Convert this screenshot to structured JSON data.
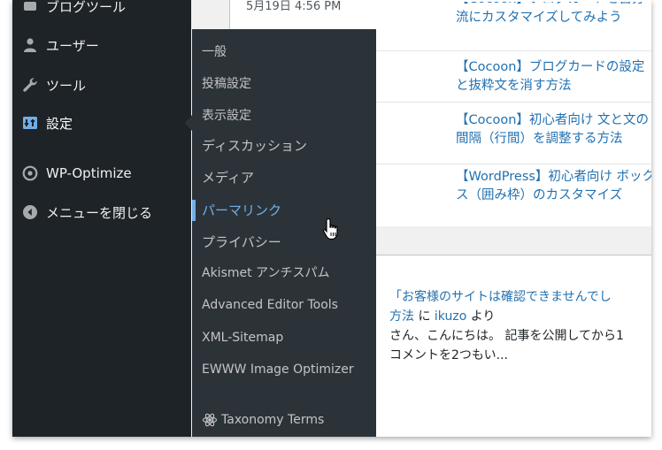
{
  "posts": [
    {
      "date": "5月19日 4:56 PM",
      "title_line1": "【Cocoon】ブログカードを自分",
      "title_line2": "流にカスタマイズしてみよう"
    },
    {
      "date": "",
      "title_line1": "【Cocoon】ブログカードの設定",
      "title_line2": "と抜粋文を消す方法"
    },
    {
      "date": "",
      "title_line1": "【Cocoon】初心者向け 文と文の",
      "title_line2": "間隔（行間）を調整する方法"
    },
    {
      "date": "",
      "title_line1": "【WordPress】初心者向け ボック",
      "title_line2": "ス（囲み枠）のカスタマイズ"
    }
  ],
  "comment": {
    "line1": "「お客様のサイトは確認できませんでし",
    "line2_link": "方法",
    "line2_mid": " に ",
    "line2_author": "ikuzo",
    "line2_end": " より",
    "line3": "さん、こんにちは。 記事を公開してから1",
    "line4": "コメントを2つもい..."
  },
  "sidebar": {
    "items": [
      {
        "label": "ブログツール",
        "icon": "tool-icon"
      },
      {
        "label": "ユーザー",
        "icon": "user-icon"
      },
      {
        "label": "ツール",
        "icon": "wrench-icon"
      },
      {
        "label": "設定",
        "icon": "settings-icon"
      },
      {
        "label": "WP-Optimize",
        "icon": "wp-optimize-icon"
      },
      {
        "label": "メニューを閉じる",
        "icon": "collapse-icon"
      }
    ]
  },
  "submenu": {
    "items": [
      {
        "label": "一般"
      },
      {
        "label": "投稿設定"
      },
      {
        "label": "表示設定"
      },
      {
        "label": "ディスカッション"
      },
      {
        "label": "メディア"
      },
      {
        "label": "パーマリンク"
      },
      {
        "label": "プライバシー"
      },
      {
        "label": "Akismet アンチスパム"
      },
      {
        "label": "Advanced Editor Tools"
      },
      {
        "label": "XML-Sitemap"
      },
      {
        "label": "EWWW Image Optimizer"
      },
      {
        "label": "Taxonomy Terms"
      }
    ]
  },
  "colors": {
    "sidebar_bg": "#1d2327",
    "flyout_bg": "#2c3338",
    "accent": "#72aee6",
    "link": "#2271b1"
  }
}
